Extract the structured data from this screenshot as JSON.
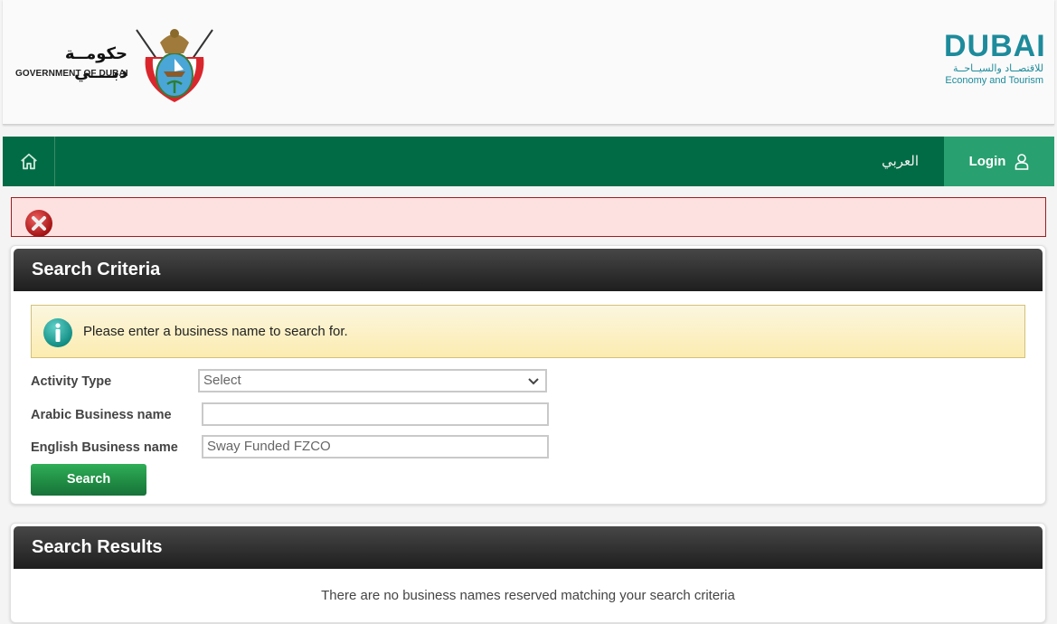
{
  "header": {
    "gov_logo": {
      "arabic": "حكومــة دبــــي",
      "english": "GOVERNMENT OF DUBAI"
    },
    "det_logo": {
      "wordmark": "DUBAI",
      "arabic": "للاقتصــاد والسيــاحــة",
      "english": "Economy and Tourism"
    }
  },
  "nav": {
    "home_icon": "home-icon",
    "language_link": "العربي",
    "login_label": "Login",
    "login_icon": "user-icon",
    "colors": {
      "nav_bg": "#006b45",
      "login_bg": "#28a06f"
    }
  },
  "error_bar": {
    "icon": "error-x-icon",
    "message": ""
  },
  "search_criteria": {
    "title": "Search Criteria",
    "info_message": "Please enter a business name to search for.",
    "fields": {
      "activity_type": {
        "label": "Activity Type",
        "selected": "Select"
      },
      "arabic_name": {
        "label": "Arabic Business name",
        "value": ""
      },
      "english_name": {
        "label": "English Business name",
        "value": "Sway Funded FZCO"
      }
    },
    "search_button": "Search"
  },
  "search_results": {
    "title": "Search Results",
    "empty_message": "There are no business names reserved matching your search criteria"
  }
}
